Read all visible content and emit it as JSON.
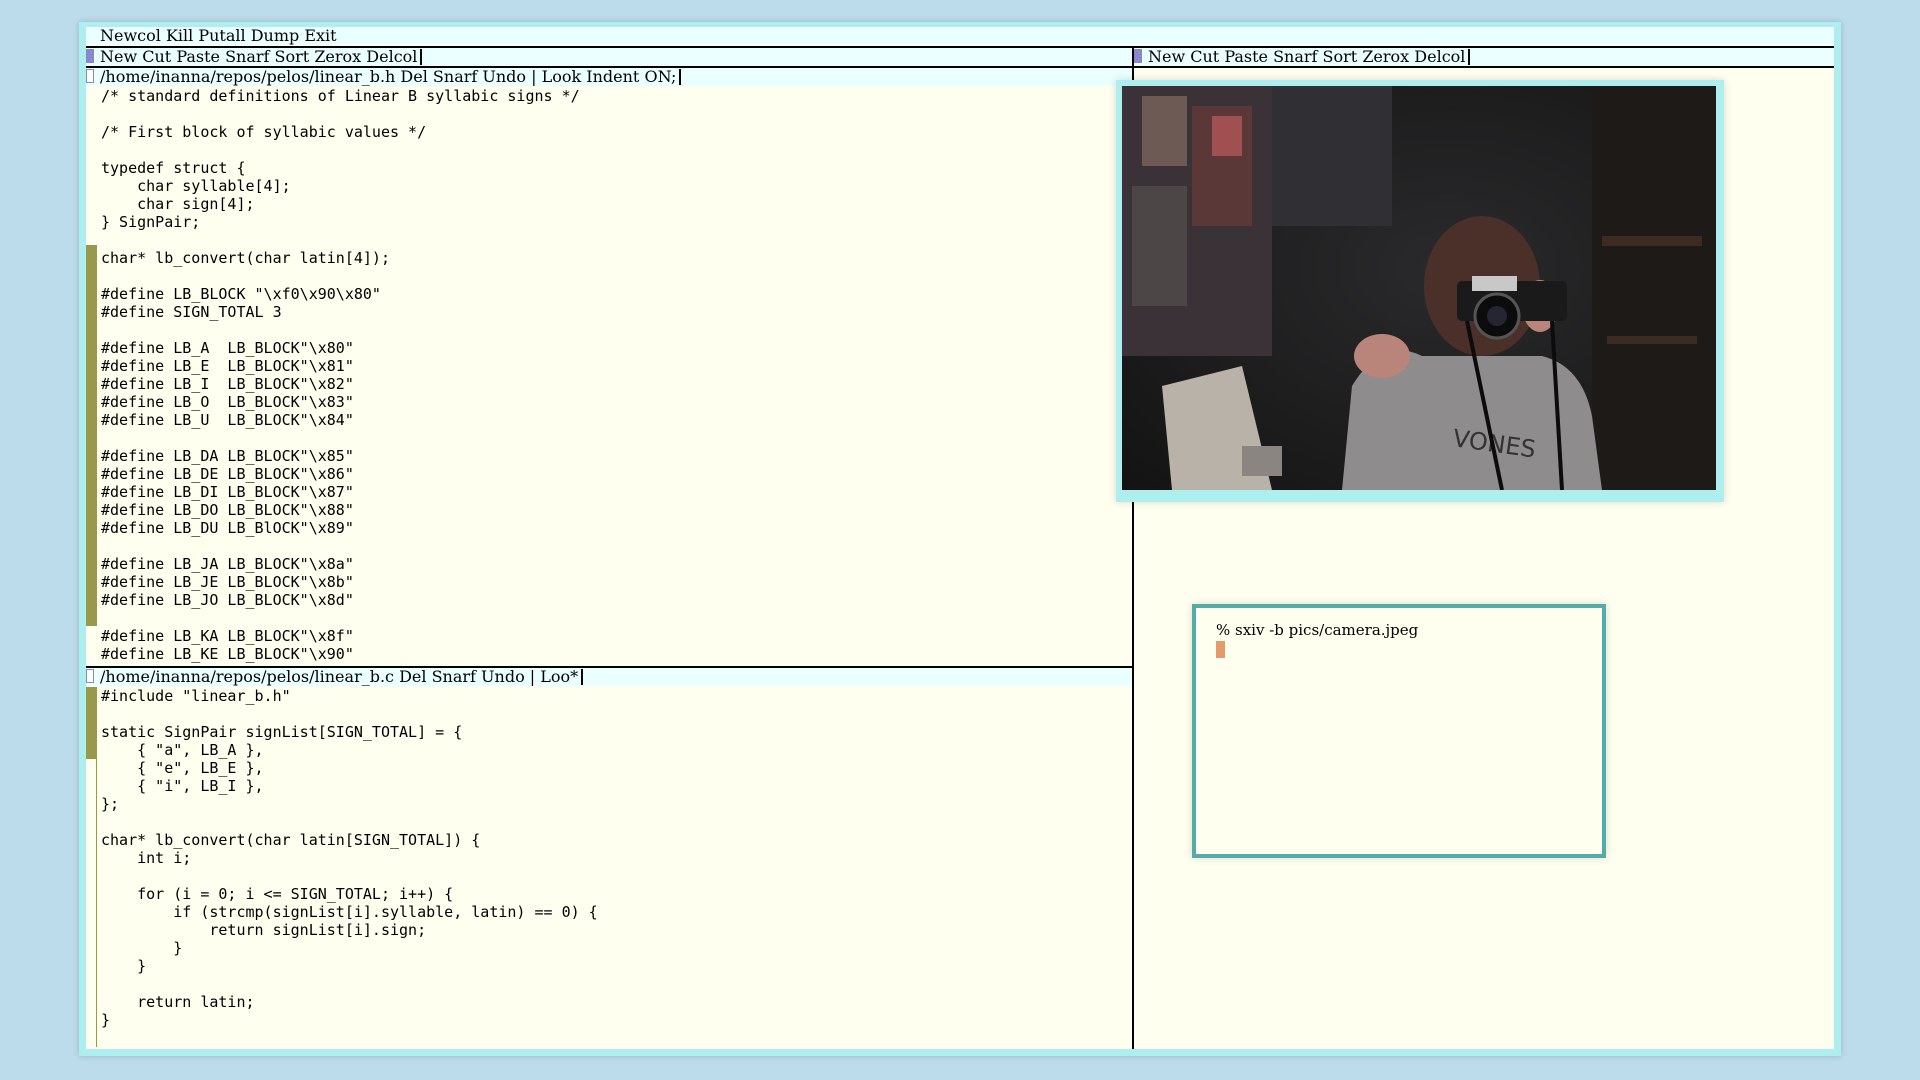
{
  "column_tag": "Newcol Kill Putall Dump Exit",
  "column_left": {
    "tag": "New Cut Paste Snarf Sort Zerox Delcol"
  },
  "column_right": {
    "tag": "New Cut Paste Snarf Sort Zerox Delcol"
  },
  "window_header": {
    "tag": "/home/inanna/repos/pelos/linear_b.h Del Snarf Undo | Look Indent ON;",
    "body": "/* standard definitions of Linear B syllabic signs */\n\n/* First block of syllabic values */\n\ntypedef struct {\n    char syllable[4];\n    char sign[4];\n} SignPair;\n\nchar* lb_convert(char latin[4]);\n\n#define LB_BLOCK \"\\xf0\\x90\\x80\"\n#define SIGN_TOTAL 3\n\n#define LB_A  LB_BLOCK\"\\x80\"\n#define LB_E  LB_BLOCK\"\\x81\"\n#define LB_I  LB_BLOCK\"\\x82\"\n#define LB_O  LB_BLOCK\"\\x83\"\n#define LB_U  LB_BLOCK\"\\x84\"\n\n#define LB_DA LB_BLOCK\"\\x85\"\n#define LB_DE LB_BLOCK\"\\x86\"\n#define LB_DI LB_BLOCK\"\\x87\"\n#define LB_DO LB_BLOCK\"\\x88\"\n#define LB_DU LB_BlOCK\"\\x89\"\n\n#define LB_JA LB_BLOCK\"\\x8a\"\n#define LB_JE LB_BLOCK\"\\x8b\"\n#define LB_JO LB_BLOCK\"\\x8d\"\n\n#define LB_KA LB_BLOCK\"\\x8f\"\n#define LB_KE LB_BLOCK\"\\x90\""
  },
  "window_source": {
    "tag": "/home/inanna/repos/pelos/linear_b.c Del Snarf Undo | Loo*",
    "body": "#include \"linear_b.h\"\n\nstatic SignPair signList[SIGN_TOTAL] = {\n    { \"a\", LB_A },\n    { \"e\", LB_E },\n    { \"i\", LB_I },\n};\n\nchar* lb_convert(char latin[SIGN_TOTAL]) {\n    int i;\n\n    for (i = 0; i <= SIGN_TOTAL; i++) {\n        if (strcmp(signList[i].syllable, latin) == 0) {\n            return signList[i].sign;\n        }\n    }\n\n    return latin;\n}"
  },
  "terminal": {
    "line1": "% sxiv -b pics/camera.jpeg"
  },
  "colors": {
    "desktop": "#bcdcec",
    "tag_bg": "#eaffff",
    "body_bg": "#fffff0",
    "border": "#aeeeee",
    "scrollbar": "#99994c",
    "window_box": "#8888cc",
    "terminal_border": "#55aaaa",
    "terminal_cursor": "#e59a6c"
  },
  "photo": {
    "subject": "person-holding-film-camera"
  }
}
